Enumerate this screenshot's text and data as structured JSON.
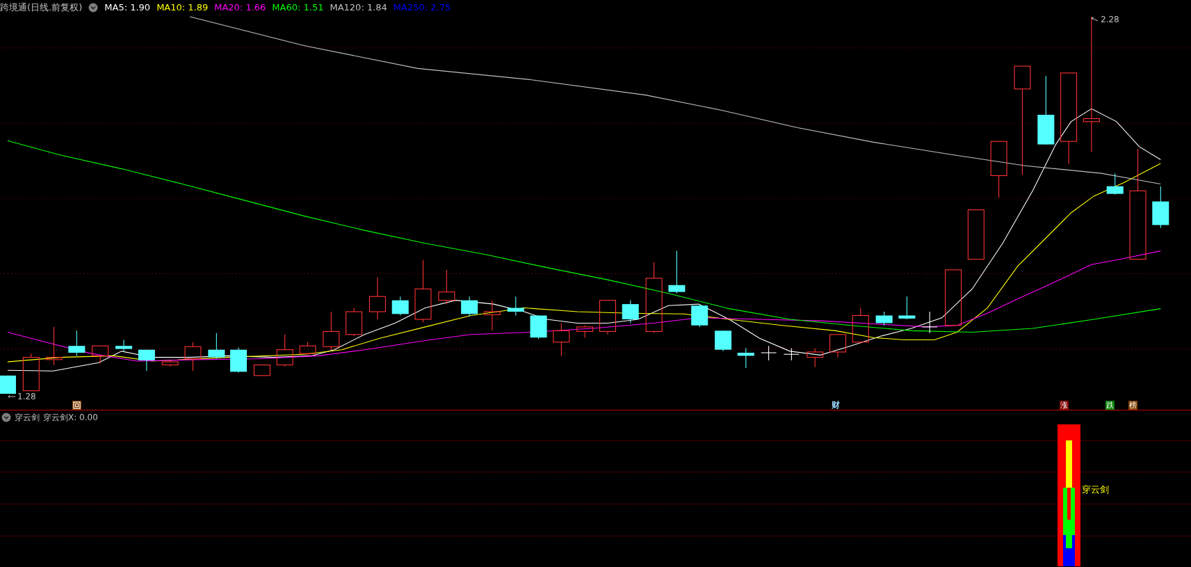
{
  "legend": {
    "title": "跨境通(日线.前复权)",
    "ma": [
      {
        "text": "MA5: 1.90",
        "color": "#ffffff"
      },
      {
        "text": "MA10: 1.89",
        "color": "#ffff00"
      },
      {
        "text": "MA20: 1.66",
        "color": "#ff00ff"
      },
      {
        "text": "MA60: 1.51",
        "color": "#00ff00"
      },
      {
        "text": "MA120: 1.84",
        "color": "#c0c0c0"
      },
      {
        "text": "MA250: 2.75",
        "color": "#0000ff"
      }
    ]
  },
  "price_labels": {
    "high": "2.28",
    "low": "1.28"
  },
  "markers": [
    {
      "kind": "icon",
      "color": "#804000"
    },
    {
      "kind": "text",
      "text": "财",
      "color": "#9fd8ff"
    },
    {
      "kind": "tag",
      "text": "涨",
      "color": "#800000"
    },
    {
      "kind": "tag",
      "text": "跌",
      "color": "#008000"
    },
    {
      "kind": "tag",
      "text": "榜",
      "color": "#804000"
    }
  ],
  "indicator": {
    "title": "穿云剑",
    "reading": "穿云剑X: 0.00",
    "bar_label": "穿云剑"
  }
}
